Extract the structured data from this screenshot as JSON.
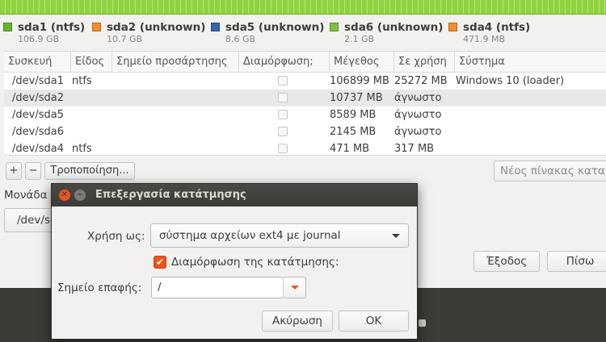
{
  "legend": [
    {
      "name": "sda1 (ntfs)",
      "size": "106.9 GB",
      "color": "#66b42d"
    },
    {
      "name": "sda2 (unknown)",
      "size": "10.7 GB",
      "color": "#f08f2f"
    },
    {
      "name": "sda5 (unknown)",
      "size": "8.6 GB",
      "color": "#3d63ad"
    },
    {
      "name": "sda6 (unknown)",
      "size": "2.1 GB",
      "color": "#7cc23e"
    },
    {
      "name": "sda4 (ntfs)",
      "size": "471.9 MB",
      "color": "#f08f2f"
    }
  ],
  "table": {
    "headers": [
      "Συσκευή",
      "Είδος",
      "Σημείο προσάρτησης",
      "Διαμόρφωση;",
      "Μέγεθος",
      "Σε χρήση",
      "Σύστημα"
    ],
    "rows": [
      {
        "device": "/dev/sda1",
        "type": "ntfs",
        "mount": "",
        "format": false,
        "size": "106899 MB",
        "used": "25272 MB",
        "system": "Windows 10 (loader)"
      },
      {
        "device": "/dev/sda2",
        "type": "",
        "mount": "",
        "format": false,
        "size": "10737 MB",
        "used": "άγνωστο",
        "system": ""
      },
      {
        "device": "/dev/sda5",
        "type": "",
        "mount": "",
        "format": false,
        "size": "8589 MB",
        "used": "άγνωστο",
        "system": ""
      },
      {
        "device": "/dev/sda6",
        "type": "",
        "mount": "",
        "format": false,
        "size": "2145 MB",
        "used": "άγνωστο",
        "system": ""
      },
      {
        "device": "/dev/sda4",
        "type": "ntfs",
        "mount": "",
        "format": false,
        "size": "471 MB",
        "used": "317 MB",
        "system": ""
      }
    ]
  },
  "toolbar": {
    "add": "+",
    "remove": "−",
    "change": "Τροποποίηση...",
    "new_table": "Νέος πίνακας κατατμ"
  },
  "bootloader": {
    "label": "Μονάδα",
    "device": "/dev/sd"
  },
  "buttons": {
    "quit": "Έξοδος",
    "back": "Πίσω"
  },
  "dialog": {
    "title": "Επεξεργασία κατάτμησης",
    "use_as_label": "Χρήση ως:",
    "use_as_value": "σύστημα αρχείων ext4 με journal",
    "format_label": "Διαμόρφωση της κατάτμησης:",
    "format_checked": true,
    "mount_label": "Σημείο επαφής:",
    "mount_value": "/",
    "cancel": "Ακύρωση",
    "ok": "OK"
  },
  "colors": {
    "bar": "#8fd43f",
    "dialog_title_bg": "#3c3b37",
    "close": "#e95420",
    "dark_strip": "#3c3b37"
  }
}
